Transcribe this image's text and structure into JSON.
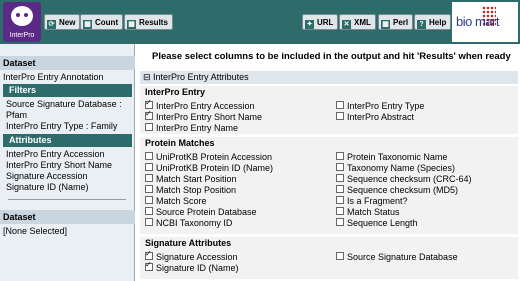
{
  "toolbar": {
    "logo_text": "InterPro",
    "new": "New",
    "count": "Count",
    "results": "Results",
    "url": "URL",
    "xml": "XML",
    "perl": "Perl",
    "help": "Help",
    "biomart": "bio mart"
  },
  "sidebar": {
    "dataset_head": "Dataset",
    "dataset_value": "InterPro Entry Annotation",
    "filters_head": "Filters",
    "filters": [
      "Source Signature Database :",
      "Pfam",
      "InterPro Entry Type : Family"
    ],
    "attributes_head": "Attributes",
    "attributes": [
      "InterPro Entry Accession",
      "InterPro Entry Short Name",
      "Signature Accession",
      "Signature ID (Name)"
    ],
    "dataset2_head": "Dataset",
    "dataset2_value": "[None Selected]"
  },
  "main": {
    "instruction": "Please select columns to be included in the output and hit 'Results' when ready",
    "group_bar": "⊟ InterPro Entry Attributes",
    "sections": [
      {
        "title": "InterPro Entry",
        "left": [
          {
            "label": "InterPro Entry Accession",
            "checked": true
          },
          {
            "label": "InterPro Entry Short Name",
            "checked": true
          },
          {
            "label": "InterPro Entry Name",
            "checked": false
          }
        ],
        "right": [
          {
            "label": "InterPro Entry Type",
            "checked": false
          },
          {
            "label": "InterPro Abstract",
            "checked": false
          }
        ]
      },
      {
        "title": "Protein Matches",
        "left": [
          {
            "label": "UniProtKB Protein Accession",
            "checked": false
          },
          {
            "label": "UniProtKB Protein ID (Name)",
            "checked": false
          },
          {
            "label": "Match Start Position",
            "checked": false
          },
          {
            "label": "Match Stop Position",
            "checked": false
          },
          {
            "label": "Match Score",
            "checked": false
          },
          {
            "label": "Source Protein Database",
            "checked": false
          },
          {
            "label": "NCBI Taxonomy ID",
            "checked": false
          }
        ],
        "right": [
          {
            "label": "Protein Taxonomic Name",
            "checked": false
          },
          {
            "label": "Taxonomy Name (Species)",
            "checked": false
          },
          {
            "label": "Sequence checksum (CRC-64)",
            "checked": false
          },
          {
            "label": "Sequence checksum (MD5)",
            "checked": false
          },
          {
            "label": "Is a Fragment?",
            "checked": false
          },
          {
            "label": "Match Status",
            "checked": false
          },
          {
            "label": "Sequence Length",
            "checked": false
          }
        ]
      },
      {
        "title": "Signature Attributes",
        "left": [
          {
            "label": "Signature Accession",
            "checked": true
          },
          {
            "label": "Signature ID (Name)",
            "checked": true
          }
        ],
        "right": [
          {
            "label": "Source Signature Database",
            "checked": false
          }
        ]
      }
    ]
  }
}
